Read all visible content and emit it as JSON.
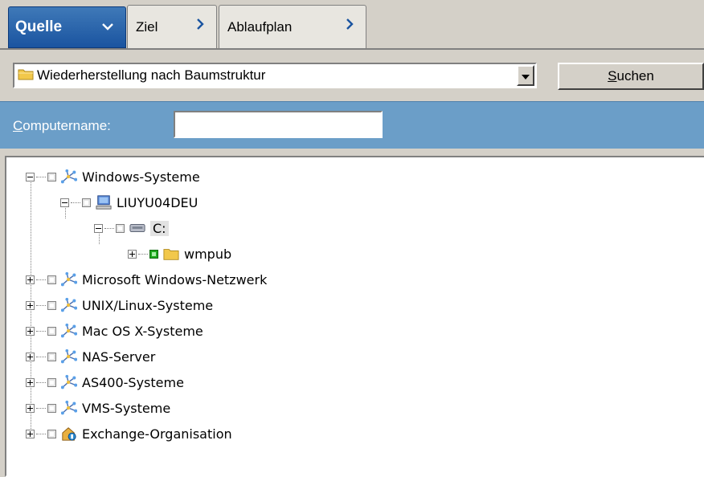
{
  "tabs": [
    {
      "label": "Quelle",
      "active": true
    },
    {
      "label": "Ziel",
      "active": false
    },
    {
      "label": "Ablaufplan",
      "active": false
    }
  ],
  "view_selector": {
    "value": "Wiederherstellung nach Baumstruktur",
    "icon": "folder-icon"
  },
  "search_button": {
    "label_underlined": "S",
    "label_rest": "uchen"
  },
  "computer_name": {
    "label_underlined": "C",
    "label_rest": "omputername:",
    "value": ""
  },
  "tree": [
    {
      "label": "Windows-Systeme",
      "icon": "network-icon",
      "expanded": true
    },
    {
      "label": "LIUYU04DEU",
      "icon": "computer-icon",
      "expanded": true
    },
    {
      "label": "C:",
      "icon": "drive-icon",
      "expanded": true
    },
    {
      "label": "wmpub",
      "icon": "folder-icon",
      "expanded": false,
      "checked": true
    },
    {
      "label": "Microsoft Windows-Netzwerk",
      "icon": "network-icon",
      "expanded": false
    },
    {
      "label": "UNIX/Linux-Systeme",
      "icon": "network-icon",
      "expanded": false
    },
    {
      "label": "Mac OS X-Systeme",
      "icon": "network-icon",
      "expanded": false
    },
    {
      "label": "NAS-Server",
      "icon": "network-icon",
      "expanded": false
    },
    {
      "label": "AS400-Systeme",
      "icon": "network-icon",
      "expanded": false
    },
    {
      "label": "VMS-Systeme",
      "icon": "network-icon",
      "expanded": false
    },
    {
      "label": "Exchange-Organisation",
      "icon": "exchange-icon",
      "expanded": false
    }
  ],
  "colors": {
    "active_tab": "#1a54a0",
    "filter_bar": "#6b9ec8",
    "window_bg": "#d4d0c8"
  }
}
